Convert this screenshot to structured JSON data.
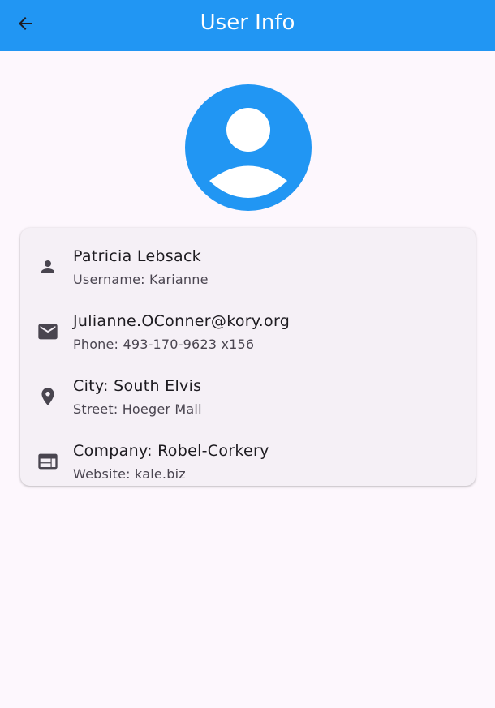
{
  "appbar": {
    "title": "User Info",
    "color": "#2196f3",
    "back_icon": "arrow-back-icon"
  },
  "avatar": {
    "icon": "account-circle-icon",
    "color": "#2196f3"
  },
  "info_card": {
    "rows": [
      {
        "icon": "person-icon",
        "title": "Patricia Lebsack",
        "subtitle": "Username: Karianne"
      },
      {
        "icon": "email-icon",
        "title": "Julianne.OConner@kory.org",
        "subtitle": "Phone: 493-170-9623 x156"
      },
      {
        "icon": "location-pin-icon",
        "title": "City: South Elvis",
        "subtitle": "Street: Hoeger Mall"
      },
      {
        "icon": "web-icon",
        "title": "Company: Robel-Corkery",
        "subtitle": "Website: kale.biz"
      }
    ]
  }
}
